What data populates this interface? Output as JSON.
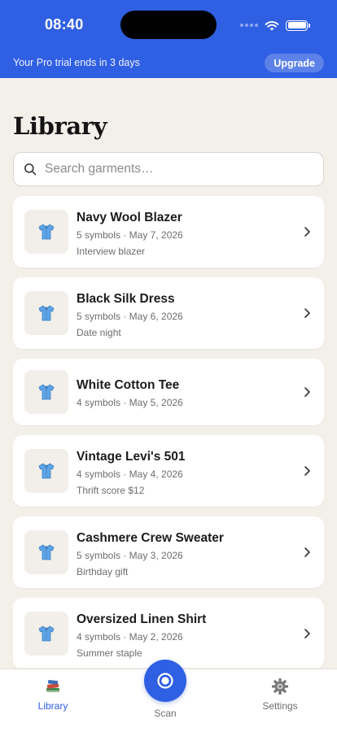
{
  "status_bar": {
    "time": "08:40"
  },
  "banner": {
    "trial_text": "Your Pro trial ends in 3 days",
    "upgrade_label": "Upgrade",
    "background_color": "#2f5fe3"
  },
  "page": {
    "title": "Library"
  },
  "search": {
    "placeholder": "Search garments…",
    "value": ""
  },
  "garments": [
    {
      "name": "Navy Wool Blazer",
      "meta": "5 symbols · May 7, 2026",
      "note": "Interview blazer",
      "icon": "shirt-icon"
    },
    {
      "name": "Black Silk Dress",
      "meta": "5 symbols · May 6, 2026",
      "note": "Date night",
      "icon": "shirt-icon"
    },
    {
      "name": "White Cotton Tee",
      "meta": "4 symbols · May 5, 2026",
      "note": "",
      "icon": "shirt-icon"
    },
    {
      "name": "Vintage Levi's 501",
      "meta": "4 symbols · May 4, 2026",
      "note": "Thrift score $12",
      "icon": "shirt-icon"
    },
    {
      "name": "Cashmere Crew Sweater",
      "meta": "5 symbols · May 3, 2026",
      "note": "Birthday gift",
      "icon": "shirt-icon"
    },
    {
      "name": "Oversized Linen Shirt",
      "meta": "4 symbols · May 2, 2026",
      "note": "Summer staple",
      "icon": "shirt-icon"
    }
  ],
  "tab_bar": {
    "library_label": "Library",
    "scan_label": "Scan",
    "settings_label": "Settings",
    "active_tab": "Library",
    "accent_color": "#2f5fe3"
  }
}
